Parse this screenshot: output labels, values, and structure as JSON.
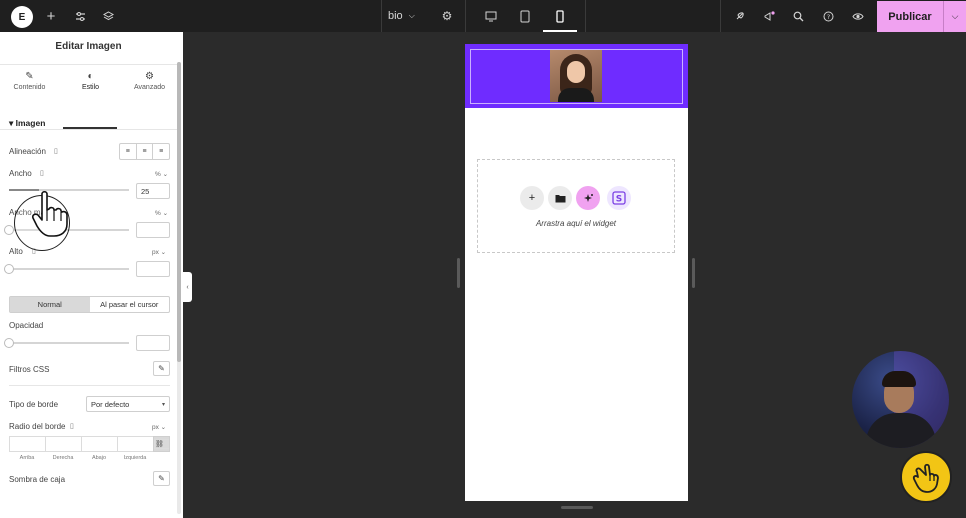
{
  "topbar": {
    "logo_text": "E",
    "page_name": "bio",
    "publish_label": "Publicar",
    "icons": [
      "elementor-logo-icon",
      "plus-icon",
      "sliders-icon",
      "layers-icon",
      "chevron-down-icon",
      "gear-icon",
      "desktop-icon",
      "tablet-icon",
      "mobile-icon",
      "rocket-icon",
      "notifications-icon",
      "search-icon",
      "help-icon",
      "eye-icon",
      "chevron-down-icon"
    ]
  },
  "panel": {
    "title": "Editar Imagen",
    "tabs": [
      {
        "label": "Contenido",
        "icon": "pencil-icon"
      },
      {
        "label": "Estilo",
        "icon": "half-circle-icon"
      },
      {
        "label": "Avanzado",
        "icon": "gear-icon"
      }
    ],
    "section_title": "Imagen",
    "alineacion_label": "Alineación",
    "ancho_label": "Ancho",
    "ancho_value": "25",
    "ancho_unit": "%",
    "ancho_max_label": "Ancho máximo",
    "ancho_max_unit": "%",
    "alto_label": "Alto",
    "alto_unit": "px",
    "state_tabs": [
      "Normal",
      "Al pasar el cursor"
    ],
    "opacidad_label": "Opacidad",
    "filtros_label": "Filtros CSS",
    "tipo_borde_label": "Tipo de borde",
    "tipo_borde_value": "Por defecto",
    "radio_label": "Radio del borde",
    "radio_unit": "px",
    "radio_sides": [
      "Arriba",
      "Derecha",
      "Abajo",
      "Izquierda"
    ],
    "sombra_label": "Sombra de caja"
  },
  "canvas": {
    "drop_text": "Arrastra aquí el widget",
    "header_color": "#6f2cff",
    "ai_button_color": "#f0a2f0"
  },
  "colors": {
    "topbar": "#1f1f1f",
    "publish": "#f0a2f0",
    "canvas_bg": "#2b2b2b"
  }
}
